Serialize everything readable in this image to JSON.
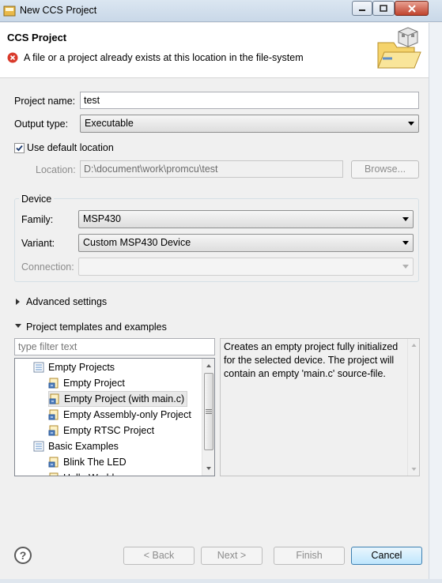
{
  "window": {
    "title": "New CCS Project",
    "controls": [
      "minimize-icon",
      "maximize-icon",
      "close-icon"
    ]
  },
  "header": {
    "title": "CCS Project",
    "message": "A file or a project already exists at this location in the file-system",
    "message_icon": "error-icon",
    "banner_icon": "new-project-wizard-icon"
  },
  "form": {
    "project_name_label": "Project name:",
    "project_name_value": "test",
    "output_type_label": "Output type:",
    "output_type_value": "Executable",
    "use_default_location_label": "Use default location",
    "use_default_location_checked": true,
    "location_label": "Location:",
    "location_value": "D:\\document\\work\\promcu\\test",
    "browse_label": "Browse..."
  },
  "device": {
    "group_label": "Device",
    "family_label": "Family:",
    "family_value": "MSP430",
    "variant_label": "Variant:",
    "variant_value": "Custom MSP430 Device",
    "connection_label": "Connection:",
    "connection_value": ""
  },
  "sections": {
    "advanced_settings": "Advanced settings",
    "templates_examples": "Project templates and examples"
  },
  "templates": {
    "filter_placeholder": "type filter text",
    "tree": [
      {
        "label": "Empty Projects",
        "level": 0,
        "icon": "folder-icon"
      },
      {
        "label": "Empty Project",
        "level": 1,
        "icon": "project-template-icon"
      },
      {
        "label": "Empty Project (with main.c)",
        "level": 1,
        "icon": "project-template-icon",
        "selected": true
      },
      {
        "label": "Empty Assembly-only Project",
        "level": 1,
        "icon": "project-template-icon"
      },
      {
        "label": "Empty RTSC Project",
        "level": 1,
        "icon": "project-template-icon"
      },
      {
        "label": "Basic Examples",
        "level": 0,
        "icon": "folder-icon"
      },
      {
        "label": "Blink The LED",
        "level": 1,
        "icon": "project-template-icon"
      },
      {
        "label": "Hello World",
        "level": 1,
        "icon": "project-template-icon"
      }
    ],
    "description": "Creates an empty project fully initialized for the selected device. The project will contain an empty 'main.c' source-file."
  },
  "buttons": {
    "help": "?",
    "back": "< Back",
    "next": "Next >",
    "finish": "Finish",
    "cancel": "Cancel"
  }
}
